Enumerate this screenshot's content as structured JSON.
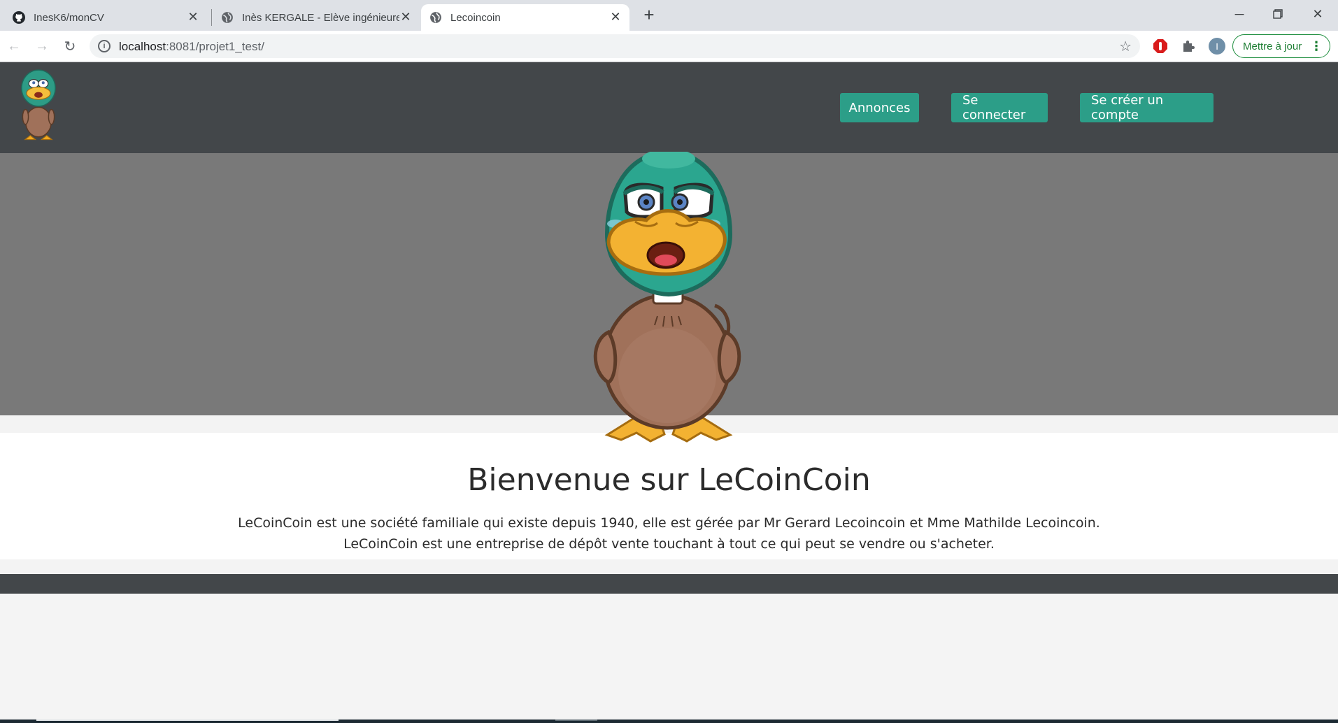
{
  "browser": {
    "tabs": [
      {
        "title": "InesK6/monCV",
        "icon": "github-icon"
      },
      {
        "title": "Inès KERGALE - Elève ingénieure",
        "icon": "globe-icon"
      },
      {
        "title": "Lecoincoin",
        "icon": "globe-icon",
        "active": true
      }
    ],
    "new_tab_label": "+",
    "url_host": "localhost",
    "url_rest": ":8081/projet1_test/",
    "profile_initial": "I",
    "update_label": "Mettre à jour"
  },
  "site": {
    "nav": {
      "annonces": "Annonces",
      "login": "Se connecter",
      "signup": "Se créer un compte"
    },
    "welcome_title": "Bienvenue sur LeCoinCoin",
    "description_line1": "LeCoinCoin est une société familiale qui existe depuis 1940, elle est gérée par Mr Gerard Lecoincoin et Mme Mathilde Lecoincoin.",
    "description_line2": "LeCoinCoin est une entreprise de dépôt vente touchant à tout ce qui peut se vendre ou s'acheter."
  },
  "colors": {
    "header_bg": "#43474a",
    "hero_bg": "#797979",
    "button_bg": "#2c9e88"
  }
}
